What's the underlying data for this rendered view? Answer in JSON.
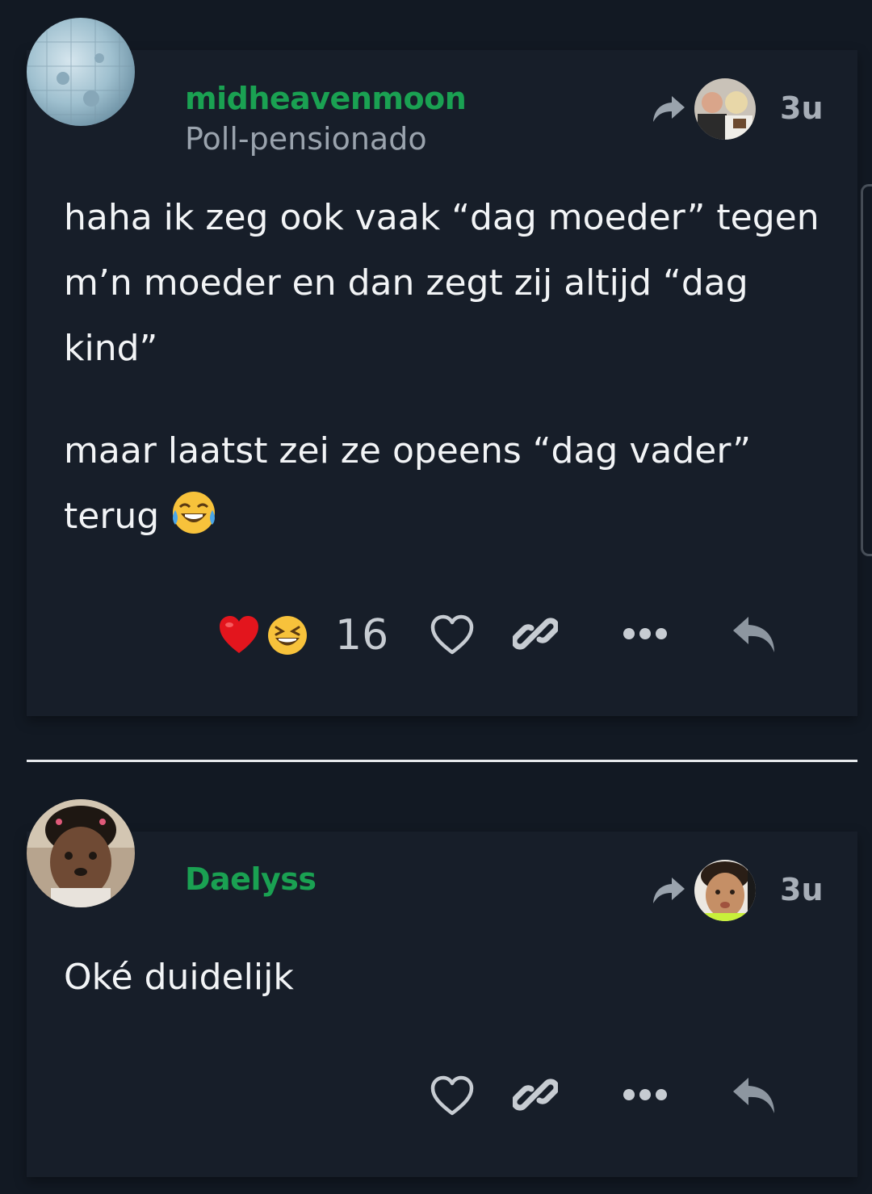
{
  "posts": [
    {
      "username": "midheavenmoon",
      "user_title": "Poll-pensionado",
      "time": "3u",
      "paragraphs": [
        "haha ik zeg ook vaak “dag moeder” tegen m’n moeder en dan zegt zij altijd “dag kind”",
        "maar laatst zei ze opeens “dag vader” terug"
      ],
      "reactions": [
        "heart",
        "laughing"
      ],
      "reaction_count": "16"
    },
    {
      "username": "Daelyss",
      "time": "3u",
      "paragraphs": [
        "Oké duidelijk"
      ]
    }
  ],
  "colors": {
    "background": "#121923",
    "card": "#171e29",
    "username": "#1aa152",
    "text": "#f2f4f6",
    "muted": "#9aa3ad",
    "icon": "#c7ccd2"
  },
  "icons": {
    "like": "heart-outline-icon",
    "link": "link-icon",
    "more": "ellipsis-icon",
    "reply": "reply-icon",
    "reply_to": "share-arrow-icon"
  }
}
